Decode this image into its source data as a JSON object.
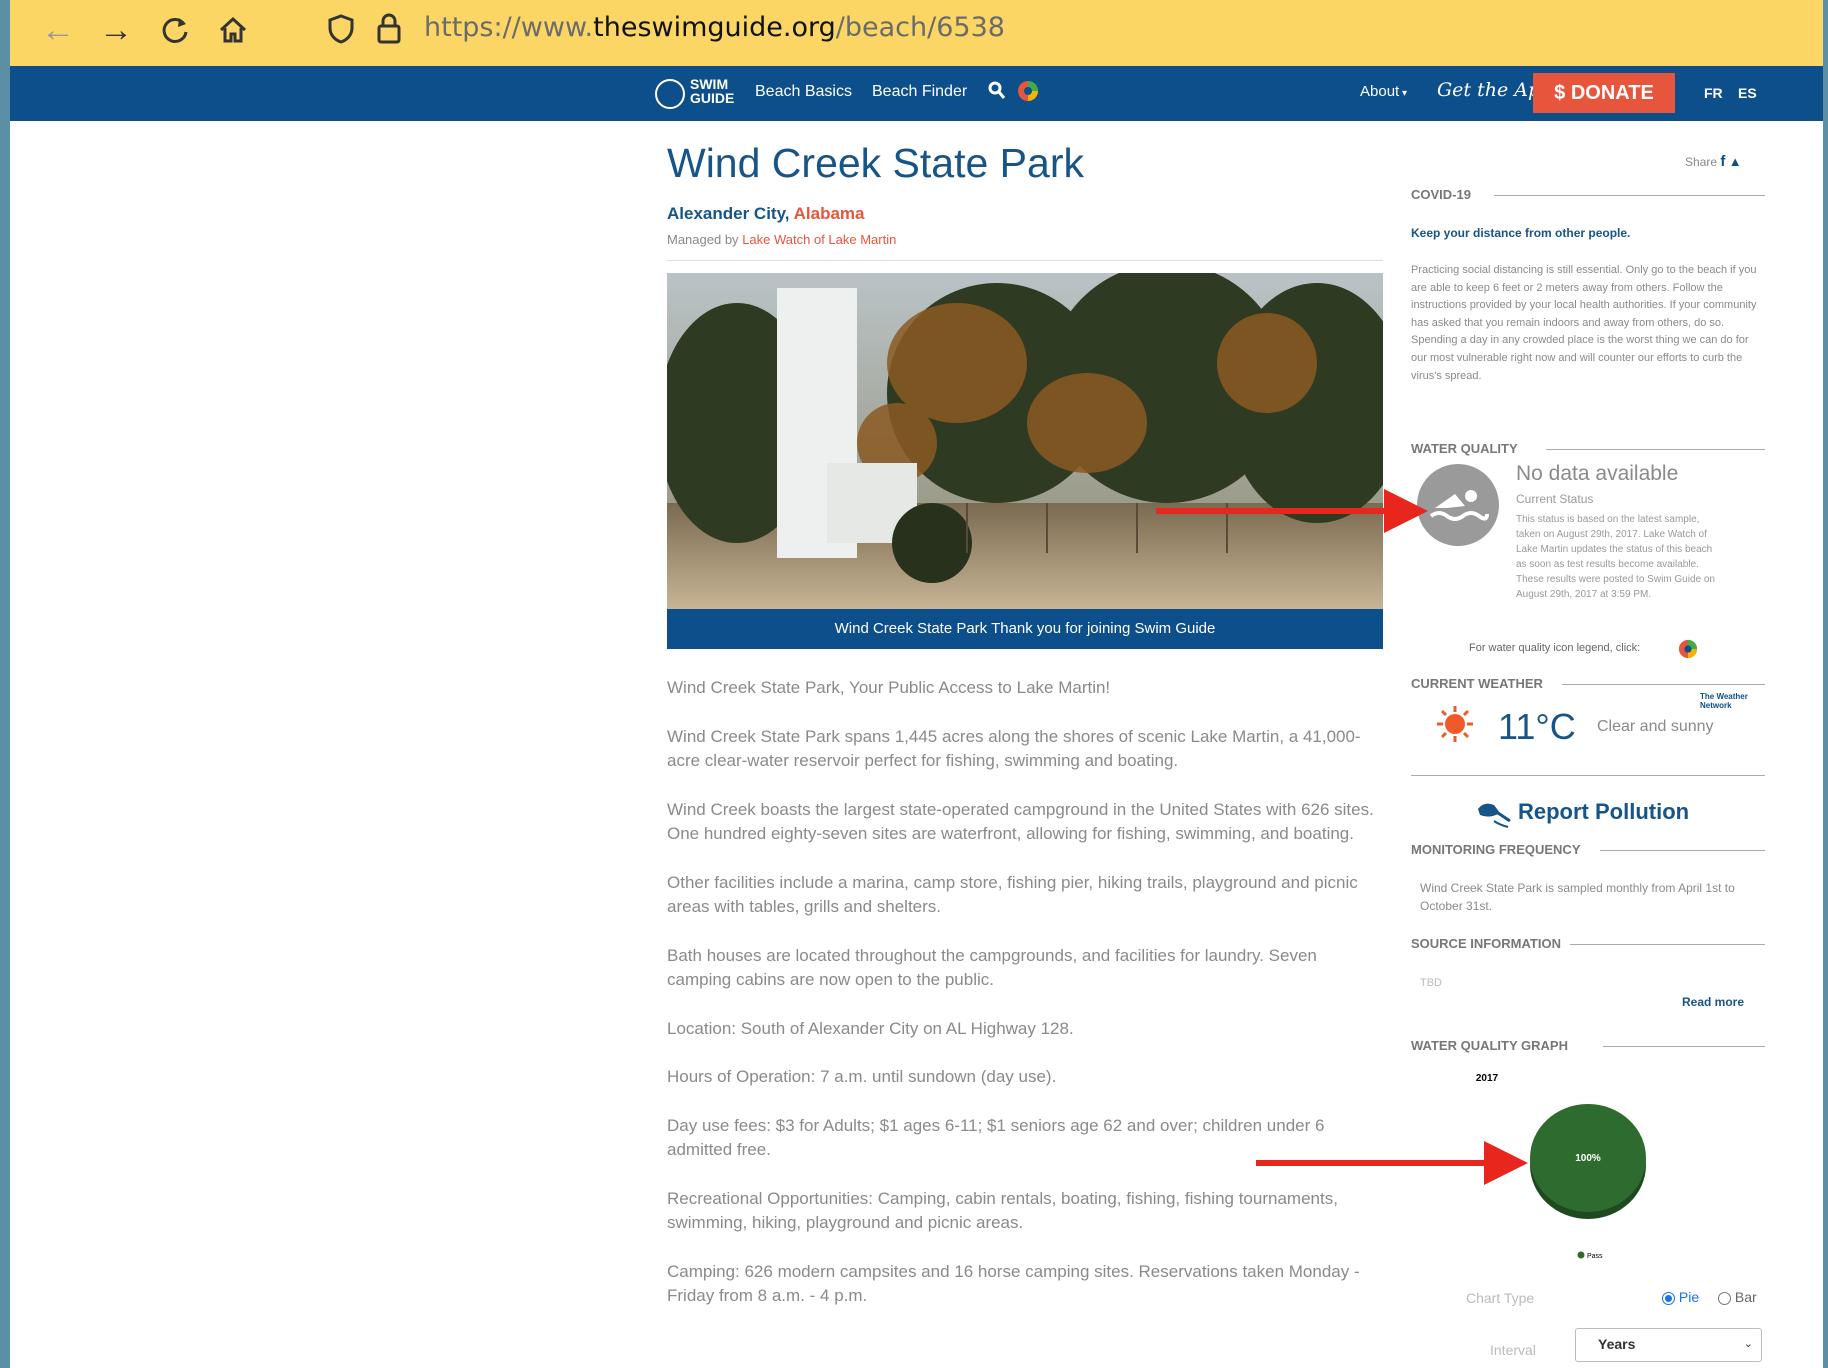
{
  "browser": {
    "url_prefix": "https://www.",
    "url_domain": "theswimguide.org",
    "url_path": "/beach/6538"
  },
  "nav": {
    "logo_line1": "SWIM",
    "logo_line2": "GUIDE",
    "beach_basics": "Beach Basics",
    "beach_finder": "Beach Finder",
    "about": "About",
    "get_app": "Get the App",
    "donate": "$ DONATE",
    "fr": "FR",
    "es": "ES"
  },
  "beach": {
    "title": "Wind Creek State Park",
    "city": "Alexander City,",
    "state": "Alabama",
    "managed_prefix": "Managed by",
    "managed_org": "Lake Watch of Lake Martin",
    "photo_caption": "Wind Creek State Park Thank you for joining Swim Guide",
    "description": [
      "Wind Creek State Park, Your Public Access to Lake Martin!",
      "Wind Creek State Park spans 1,445 acres along the shores of scenic Lake Martin, a 41,000-acre clear-water reservoir perfect for fishing, swimming and boating.",
      "Wind Creek boasts the largest state-operated campground in the United States with 626 sites. One hundred eighty-seven sites are waterfront, allowing for fishing, swimming, and boating.",
      "Other facilities include a marina, camp store, fishing pier, hiking trails, playground and picnic areas with tables, grills and shelters.",
      "Bath houses are located throughout the campgrounds, and facilities for laundry. Seven camping cabins are now open to the public.",
      "Location: South of Alexander City on AL Highway 128.",
      "Hours of Operation: 7 a.m. until sundown (day use).",
      "Day use fees: $3 for Adults; $1 ages 6-11; $1 seniors age 62 and over; children under 6 admitted free.",
      "Recreational Opportunities: Camping, cabin rentals, boating, fishing, fishing tournaments, swimming, hiking, playground and picnic areas.",
      "Camping: 626 modern campsites and 16 horse camping sites. Reservations taken Monday - Friday from 8 a.m. - 4 p.m."
    ]
  },
  "sidebar": {
    "share": "Share",
    "covid_heading": "COVID-19",
    "covid_bold": "Keep your distance from other people.",
    "covid_text": "Practicing social distancing is still essential. Only go to the beach if you are able to keep 6 feet or 2 meters away from others. Follow the instructions provided by your local health authorities. If your community has asked that you remain indoors and away from others, do so. Spending a day in any crowded place is the worst thing we can do for our most vulnerable right now and will counter our efforts to curb the virus's spread.",
    "wq_heading": "WATER QUALITY",
    "wq_status": "No data available",
    "wq_current": "Current Status",
    "wq_note": "This status is based on the latest sample, taken on August 29th, 2017. Lake Watch of Lake Martin updates the status of this beach as soon as test results become available. These results were posted to Swim Guide on August 29th, 2017 at 3:59 PM.",
    "legend_link": "For water quality icon legend, click:",
    "weather_heading": "CURRENT WEATHER",
    "weather_network": "The Weather Network",
    "temp": "11°C",
    "weather_desc": "Clear and sunny",
    "report_pollution": "Report Pollution",
    "freq_heading": "MONITORING FREQUENCY",
    "freq_text": "Wind Creek State Park is sampled monthly from April 1st to October 31st.",
    "source_heading": "SOURCE INFORMATION",
    "source_text": "TBD",
    "read_more": "Read more",
    "graph_heading": "WATER QUALITY GRAPH",
    "chart_type_label": "Chart Type",
    "pie_label": "Pie",
    "bar_label": "Bar",
    "interval_label": "Interval",
    "interval_value": "Years"
  },
  "colors": {
    "navy": "#0d4f8b",
    "accent": "#e8553d",
    "pass_green": "#2e6b2e"
  },
  "chart_data": {
    "type": "pie",
    "title": "2017",
    "categories": [
      "Pass"
    ],
    "values": [
      100
    ],
    "data_labels": [
      "100%"
    ],
    "legend": "bottom"
  }
}
